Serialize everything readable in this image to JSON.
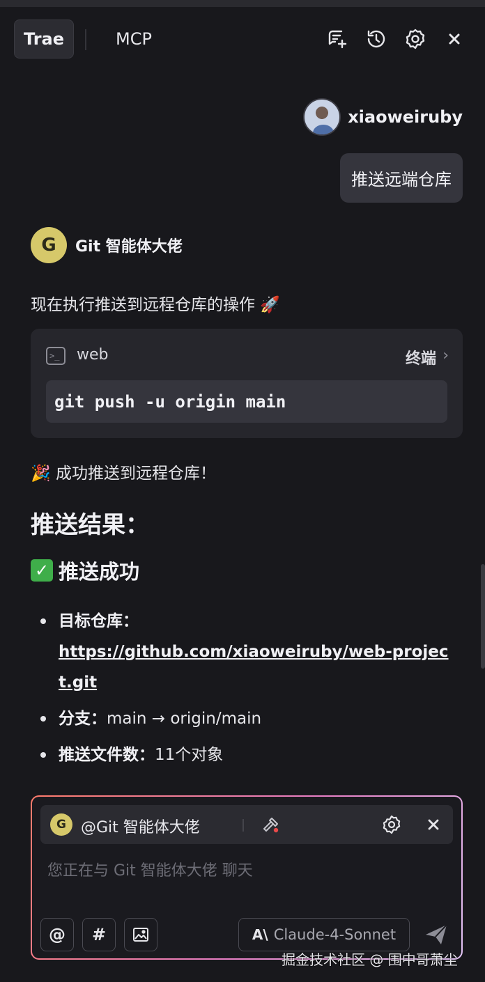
{
  "header": {
    "tabs": [
      {
        "label": "Trae",
        "active": true
      },
      {
        "label": "MCP",
        "active": false
      }
    ],
    "icons": [
      "new-chat-icon",
      "history-icon",
      "settings-icon",
      "close-icon"
    ]
  },
  "user_message": {
    "username": "xiaoweiruby",
    "text": "推送远端仓库"
  },
  "agent": {
    "name": "Git 智能体大佬",
    "avatar_letter": "G",
    "intro": "现在执行推送到远程仓库的操作 🚀",
    "terminal": {
      "label": "web",
      "link_label": "终端",
      "command": "git push -u origin main"
    },
    "success_line": "🎉 成功推送到远程仓库！",
    "heading": "推送结果：",
    "subheading": "推送成功",
    "bullets": {
      "repo_label": "目标仓库：",
      "repo_url": "https://github.com/xiaoweiruby/web-project.git",
      "branch_label": "分支：",
      "branch_value": "main → origin/main",
      "files_label": "推送文件数：",
      "files_value": "11个对象"
    }
  },
  "composer": {
    "agent_chip": "@Git 智能体大佬",
    "placeholder": "您正在与 Git 智能体大佬 聊天",
    "at_label": "@",
    "hash_label": "#",
    "model_logo": "A\\",
    "model": "Claude-4-Sonnet"
  },
  "colors": {
    "background": "#18181c",
    "agent_avatar": "#d6c86a",
    "composer_gradient_start": "#ff7b6b",
    "composer_gradient_end": "#e3c5f7",
    "check": "#3fae4a"
  },
  "watermark": "掘金技术社区 @ 围中哥萧尘"
}
